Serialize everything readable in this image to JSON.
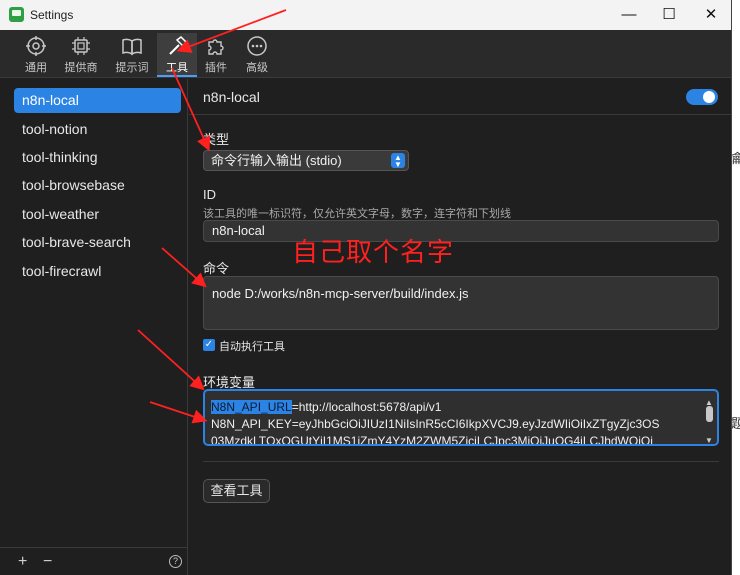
{
  "window": {
    "title": "Settings",
    "controls": {
      "minimize": "—",
      "maximize": "☐",
      "close": "✕"
    }
  },
  "toolbar": {
    "tabs": [
      {
        "label": "通用",
        "icon": "gear-icon"
      },
      {
        "label": "提供商",
        "icon": "chip-icon"
      },
      {
        "label": "提示词",
        "icon": "book-icon"
      },
      {
        "label": "工具",
        "icon": "hammer-icon",
        "active": true
      },
      {
        "label": "插件",
        "icon": "puzzle-icon"
      },
      {
        "label": "高级",
        "icon": "more-icon"
      }
    ]
  },
  "sidebar": {
    "items": [
      {
        "label": "n8n-local",
        "selected": true
      },
      {
        "label": "tool-notion"
      },
      {
        "label": "tool-thinking"
      },
      {
        "label": "tool-browsebase"
      },
      {
        "label": "tool-weather"
      },
      {
        "label": "tool-brave-search"
      },
      {
        "label": "tool-firecrawl"
      }
    ],
    "footer": {
      "add": "+",
      "remove": "−",
      "help": "?"
    }
  },
  "main": {
    "title": "n8n-local",
    "enabled": true,
    "type": {
      "label": "类型",
      "value": "命令行输入输出 (stdio)"
    },
    "id": {
      "label": "ID",
      "hint": "该工具的唯一标识符，仅允许英文字母，数字，连字符和下划线",
      "value": "n8n-local"
    },
    "command": {
      "label": "命令",
      "value": "node D:/works/n8n-mcp-server/build/index.js"
    },
    "auto_execute": {
      "label": "自动执行工具",
      "checked": true
    },
    "env": {
      "label": "环境变量",
      "line1_key": "N8N_API_URL",
      "line1_rest": "=http://localhost:5678/api/v1",
      "line2": "N8N_API_KEY=eyJhbGciOiJIUzI1NiIsInR5cCI6IkpXVCJ9.eyJzdWIiOiIxZTgyZjc3OS",
      "line3": "03MzdkLTQxOGUtYjI1MS1iZmY4YzM2ZWM5ZjciLCJpc3MiOiJuOG4iLCJhdWQiOi"
    },
    "view_tools_button": "查看工具"
  },
  "annotation": {
    "overlay_text": "自己取个名字",
    "color": "#ff2020"
  },
  "background_fragments": [
    "龠",
    "题"
  ],
  "colors": {
    "accent": "#2b83e4",
    "window_bg": "#1f1f1f",
    "annotation_red": "#ff2020"
  }
}
